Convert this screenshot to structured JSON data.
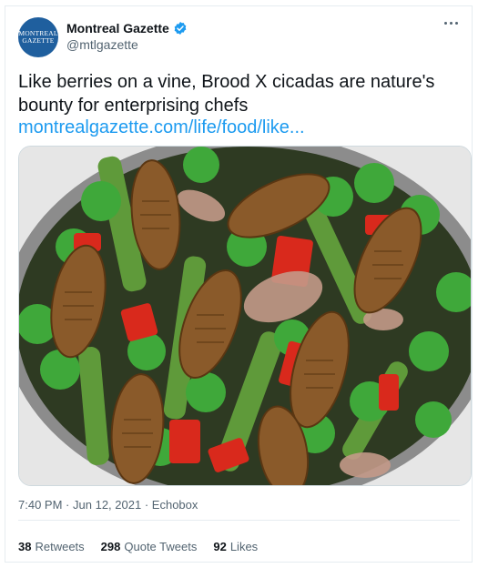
{
  "account": {
    "logo_lines": [
      "MONTREAL",
      "GAZETTE"
    ],
    "display_name": "Montreal Gazette",
    "handle": "@mtlgazette",
    "verified_icon": "verified-badge-icon",
    "more_icon": "more-options-icon"
  },
  "tweet": {
    "text": "Like berries on a vine, Brood X cicadas are nature's bounty for enterprising chefs",
    "link": "montrealgazette.com/life/food/like..."
  },
  "media": {
    "icon": "photo-of-cicadas-in-salad",
    "colors": {
      "background": "#e6e6e6",
      "pan_rim": "#8c8c8c",
      "edamame": "#3fa83a",
      "asparagus": "#5f9a3a",
      "pepper": "#d9291c",
      "onion": "#c49a8a",
      "cicada": "#8a5a2a"
    }
  },
  "meta": {
    "time": "7:40 PM",
    "separator": "·",
    "date": "Jun 12, 2021",
    "source": "Echobox"
  },
  "stats": [
    {
      "count": "38",
      "label": "Retweets"
    },
    {
      "count": "298",
      "label": "Quote Tweets"
    },
    {
      "count": "92",
      "label": "Likes"
    }
  ],
  "colors": {
    "link": "#1d9bf0",
    "verified": "#1d9bf0",
    "avatar": "#1f5f9e",
    "secondary_text": "#536471"
  }
}
